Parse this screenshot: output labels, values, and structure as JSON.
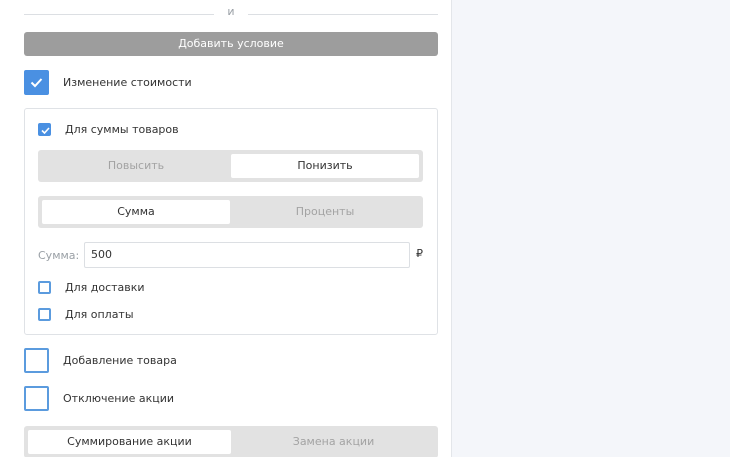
{
  "divider": {
    "text": "и"
  },
  "add_condition_button": "Добавить условие",
  "price_change": {
    "label": "Изменение стоимости",
    "checked": true,
    "goods_sum": {
      "label": "Для суммы товаров",
      "checked": true
    },
    "direction": {
      "options": [
        "Повысить",
        "Понизить"
      ],
      "selected": "Понизить"
    },
    "mode": {
      "options": [
        "Сумма",
        "Проценты"
      ],
      "selected": "Сумма"
    },
    "amount": {
      "label": "Сумма:",
      "value": "500",
      "currency": "₽"
    },
    "delivery": {
      "label": "Для доставки",
      "checked": false
    },
    "payment": {
      "label": "Для оплаты",
      "checked": false
    }
  },
  "add_product": {
    "label": "Добавление товара",
    "checked": false
  },
  "disable_promo": {
    "label": "Отключение акции",
    "checked": false
  },
  "promo_mode": {
    "options": [
      "Суммирование акции",
      "Замена акции"
    ],
    "selected": "Суммирование акции"
  },
  "colors": {
    "accent": "#4a90e2",
    "button_bg": "#9d9d9d",
    "segment_bg": "#e2e2e2"
  }
}
